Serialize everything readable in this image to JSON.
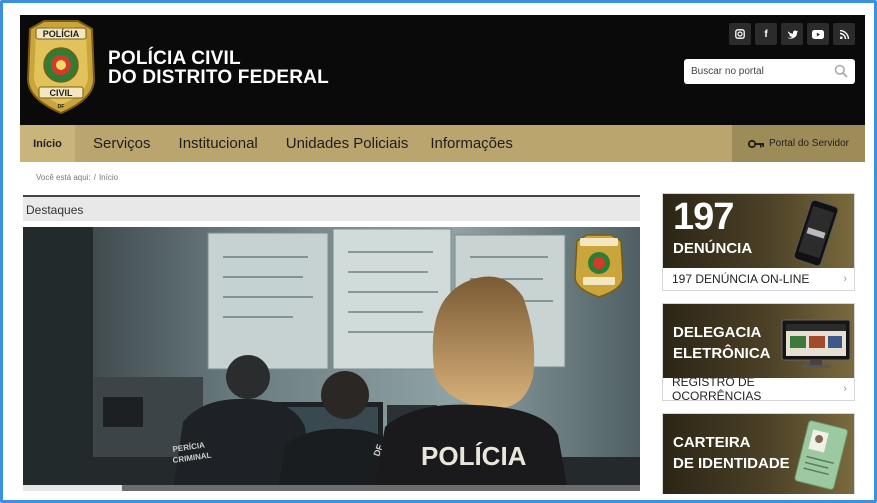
{
  "header": {
    "title_line1": "POLÍCIA CIVIL",
    "title_line2": "DO DISTRITO FEDERAL",
    "badge_top": "POLÍCIA",
    "badge_bottom": "CIVIL",
    "badge_tiny": "DF",
    "socials": [
      {
        "icon": "instagram-icon",
        "glyph": "◙"
      },
      {
        "icon": "facebook-icon",
        "glyph": "f"
      },
      {
        "icon": "twitter-icon",
        "glyph": "t"
      },
      {
        "icon": "youtube-icon",
        "glyph": "▶"
      },
      {
        "icon": "rss-icon",
        "glyph": ")"
      }
    ],
    "search_placeholder": "Buscar no portal"
  },
  "nav": {
    "home": "Início",
    "items": [
      "Serviços",
      "Institucional",
      "Unidades Policiais",
      "Informações"
    ],
    "portal": "Portal do Servidor"
  },
  "breadcrumb": {
    "prefix": "Você está aqui:",
    "current": "Início"
  },
  "highlights": {
    "title": "Destaques",
    "photo_text": "POLÍCIA",
    "vest_text_1": "PERÍCIA",
    "vest_text_2": "CRIMINAL",
    "vest_text_3": "DF",
    "slide_progress": 0.16
  },
  "cards": [
    {
      "big": "197",
      "sub": "DENÚNCIA",
      "link": "197 DENÚNCIA ON-LINE"
    },
    {
      "line1": "DELEGACIA",
      "line2": "ELETRÔNICA",
      "link": "REGISTRO DE OCORRÊNCIAS"
    },
    {
      "line1": "CARTEIRA",
      "line2": "DE IDENTIDADE"
    }
  ],
  "colors": {
    "frame": "#3d8fe0",
    "header_bg": "#0a0a0a",
    "nav_bg": "#b9a56d",
    "nav_portal_bg": "#9d8b58"
  }
}
